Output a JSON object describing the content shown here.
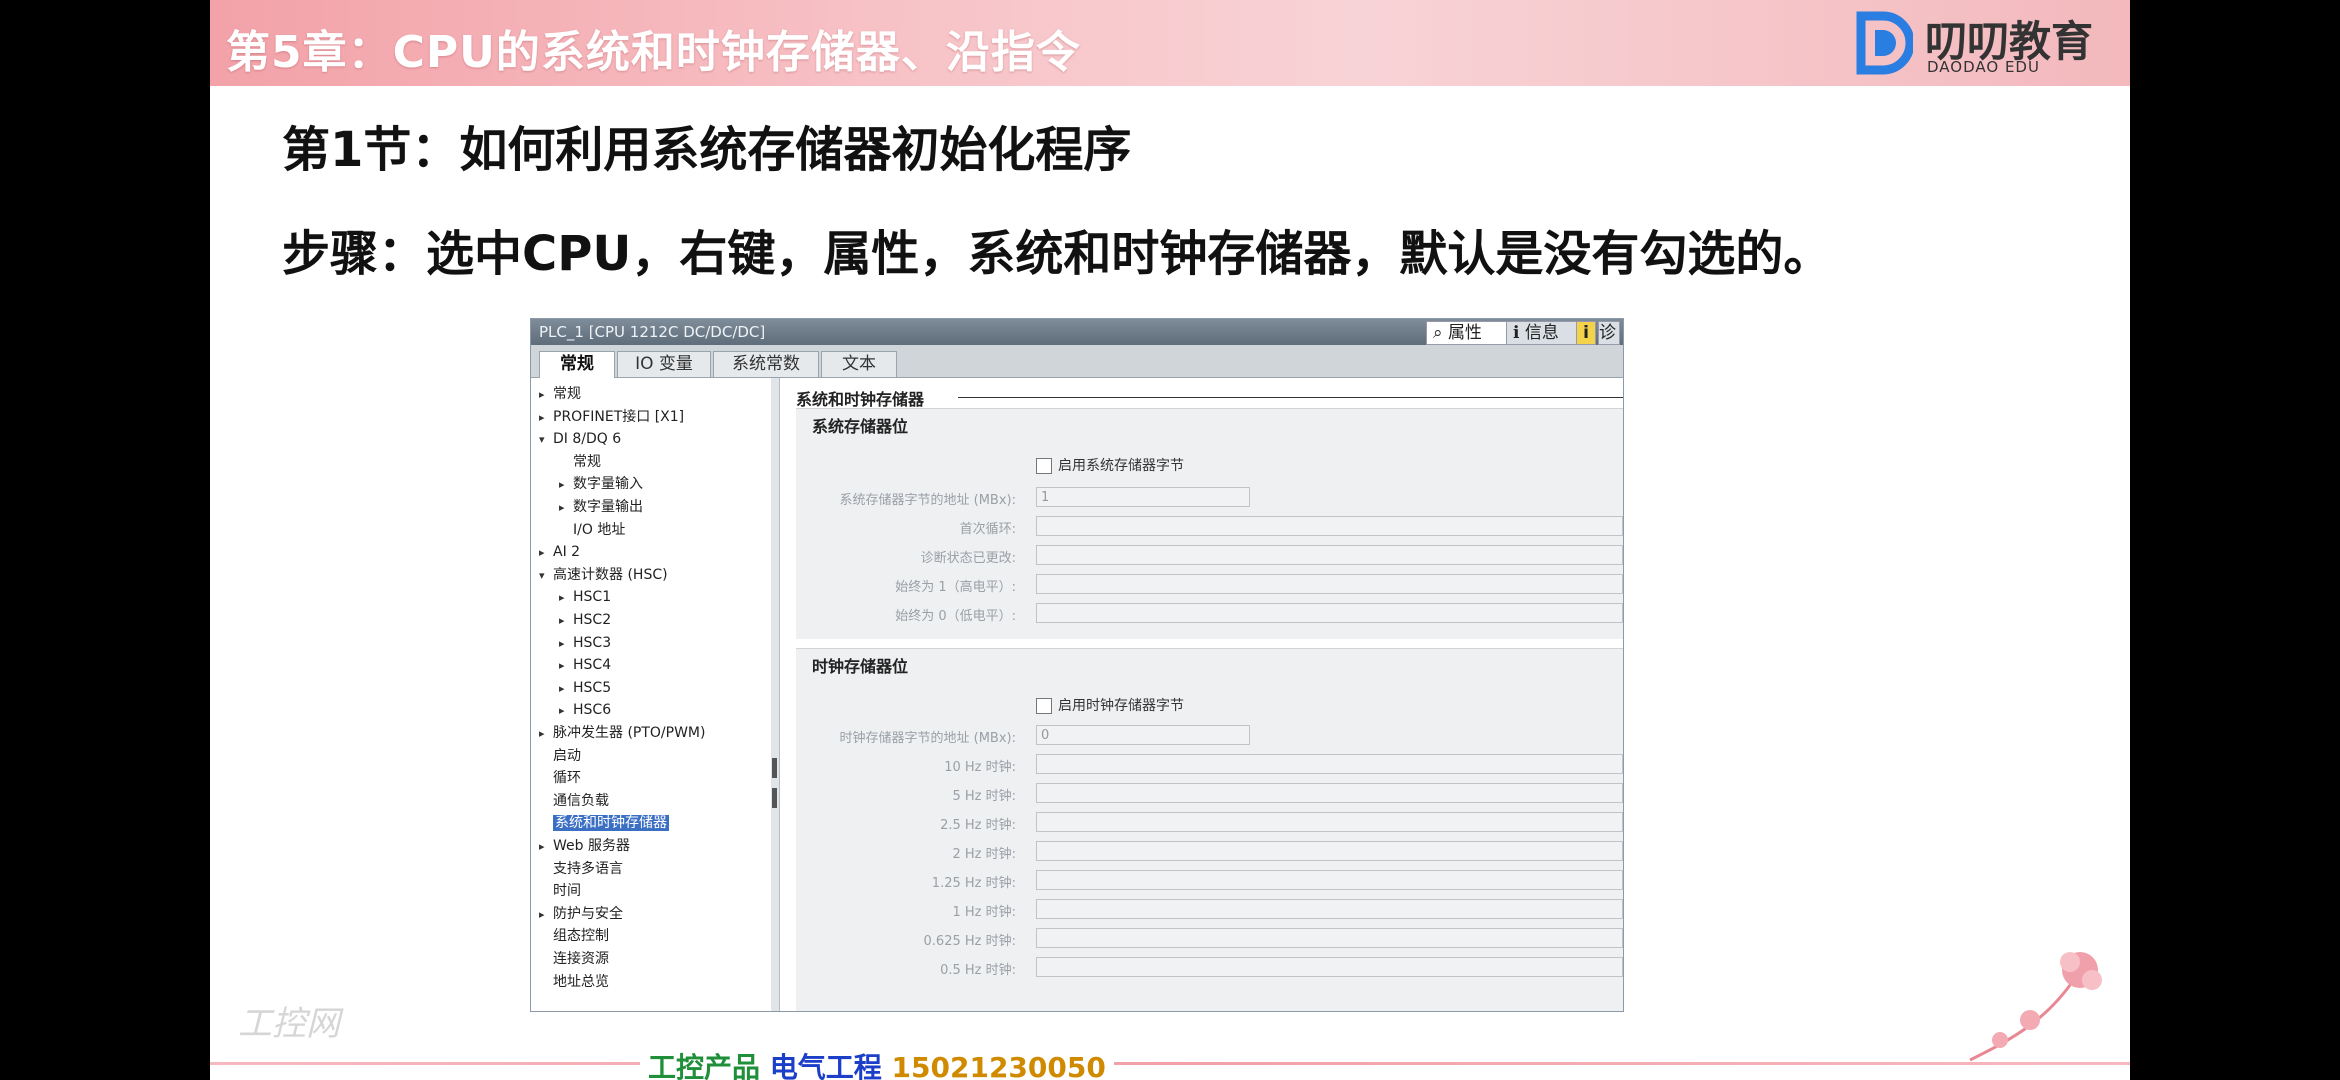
{
  "slide": {
    "banner_title": "第5章：CPU的系统和时钟存储器、沿指令",
    "logo_text": "叨叨教育",
    "logo_sub": "DAODAO EDU",
    "section_title": "第1节：如何利用系统存储器初始化程序",
    "steps": "步骤：选中CPU，右键，属性，系统和时钟存储器，默认是没有勾选的。"
  },
  "window": {
    "title": "PLC_1 [CPU 1212C DC/DC/DC]",
    "prop_tabs": [
      "属性",
      "信息",
      "i",
      "诊"
    ],
    "tabs": [
      "常规",
      "IO 变量",
      "系统常数",
      "文本"
    ],
    "tree": [
      {
        "label": "常规",
        "arrow": "▸",
        "indent": 0
      },
      {
        "label": "PROFINET接口 [X1]",
        "arrow": "▸",
        "indent": 0
      },
      {
        "label": "DI 8/DQ 6",
        "arrow": "▾",
        "indent": 0
      },
      {
        "label": "常规",
        "arrow": "",
        "indent": 1
      },
      {
        "label": "数字量输入",
        "arrow": "▸",
        "indent": 1
      },
      {
        "label": "数字量输出",
        "arrow": "▸",
        "indent": 1
      },
      {
        "label": "I/O 地址",
        "arrow": "",
        "indent": 1
      },
      {
        "label": "AI 2",
        "arrow": "▸",
        "indent": 0
      },
      {
        "label": "高速计数器 (HSC)",
        "arrow": "▾",
        "indent": 0
      },
      {
        "label": "HSC1",
        "arrow": "▸",
        "indent": 1
      },
      {
        "label": "HSC2",
        "arrow": "▸",
        "indent": 1
      },
      {
        "label": "HSC3",
        "arrow": "▸",
        "indent": 1
      },
      {
        "label": "HSC4",
        "arrow": "▸",
        "indent": 1
      },
      {
        "label": "HSC5",
        "arrow": "▸",
        "indent": 1
      },
      {
        "label": "HSC6",
        "arrow": "▸",
        "indent": 1
      },
      {
        "label": "脉冲发生器 (PTO/PWM)",
        "arrow": "▸",
        "indent": 0
      },
      {
        "label": "启动",
        "arrow": "",
        "indent": 0
      },
      {
        "label": "循环",
        "arrow": "",
        "indent": 0
      },
      {
        "label": "通信负载",
        "arrow": "",
        "indent": 0
      },
      {
        "label": "系统和时钟存储器",
        "arrow": "",
        "indent": 0,
        "selected": true
      },
      {
        "label": "Web 服务器",
        "arrow": "▸",
        "indent": 0
      },
      {
        "label": "支持多语言",
        "arrow": "",
        "indent": 0
      },
      {
        "label": "时间",
        "arrow": "",
        "indent": 0
      },
      {
        "label": "防护与安全",
        "arrow": "▸",
        "indent": 0
      },
      {
        "label": "组态控制",
        "arrow": "",
        "indent": 0
      },
      {
        "label": "连接资源",
        "arrow": "",
        "indent": 0
      },
      {
        "label": "地址总览",
        "arrow": "",
        "indent": 0
      }
    ],
    "content": {
      "heading": "系统和时钟存储器",
      "system": {
        "title": "系统存储器位",
        "checkbox": "启用系统存储器字节",
        "fields": [
          {
            "label": "系统存储器字节的地址 (MBx):",
            "value": "1"
          },
          {
            "label": "首次循环:",
            "value": ""
          },
          {
            "label": "诊断状态已更改:",
            "value": ""
          },
          {
            "label": "始终为 1（高电平）:",
            "value": ""
          },
          {
            "label": "始终为 0（低电平）:",
            "value": ""
          }
        ]
      },
      "clock": {
        "title": "时钟存储器位",
        "checkbox": "启用时钟存储器字节",
        "fields": [
          {
            "label": "时钟存储器字节的地址 (MBx):",
            "value": "0"
          },
          {
            "label": "10 Hz 时钟:",
            "value": ""
          },
          {
            "label": "5 Hz 时钟:",
            "value": ""
          },
          {
            "label": "2.5 Hz 时钟:",
            "value": ""
          },
          {
            "label": "2 Hz 时钟:",
            "value": ""
          },
          {
            "label": "1.25 Hz 时钟:",
            "value": ""
          },
          {
            "label": "1 Hz 时钟:",
            "value": ""
          },
          {
            "label": "0.625 Hz 时钟:",
            "value": ""
          },
          {
            "label": "0.5 Hz 时钟:",
            "value": ""
          }
        ]
      }
    }
  },
  "footer": {
    "part1": "工控产品",
    "part2": "电气工程",
    "phone": "15021230050"
  },
  "watermark": "工控网",
  "colors": {
    "banner": "#f4b3b8",
    "selection": "#3b6fc4",
    "footer_green": "#1f8f3a",
    "footer_blue": "#1c3fc9",
    "footer_gold": "#d08a00"
  }
}
